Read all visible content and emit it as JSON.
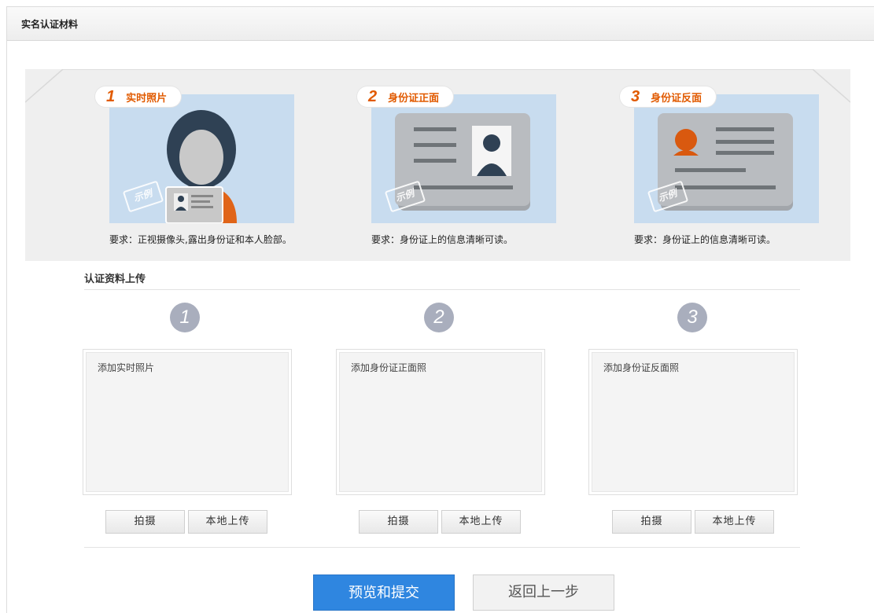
{
  "header": {
    "title": "实名认证材料"
  },
  "examples": [
    {
      "num": "1",
      "label": "实时照片",
      "requirement": "要求：正视摄像头,露出身份证和本人脸部。",
      "stamp": "示例"
    },
    {
      "num": "2",
      "label": "身份证正面",
      "requirement": "要求：身份证上的信息清晰可读。",
      "stamp": "示例"
    },
    {
      "num": "3",
      "label": "身份证反面",
      "requirement": "要求：身份证上的信息清晰可读。",
      "stamp": "示例"
    }
  ],
  "upload": {
    "title": "认证资料上传",
    "slots": [
      {
        "num": "1",
        "placeholder": "添加实时照片",
        "shoot_label": "拍摄",
        "local_label": "本地上传"
      },
      {
        "num": "2",
        "placeholder": "添加身份证正面照",
        "shoot_label": "拍摄",
        "local_label": "本地上传"
      },
      {
        "num": "3",
        "placeholder": "添加身份证反面照",
        "shoot_label": "拍摄",
        "local_label": "本地上传"
      }
    ]
  },
  "actions": {
    "submit_label": "预览和提交",
    "back_label": "返回上一步"
  },
  "colors": {
    "accent_orange": "#e15a00",
    "primary_blue": "#2f86e0",
    "example_bg": "#c8dcef",
    "step_circle": "#a9aebd"
  }
}
